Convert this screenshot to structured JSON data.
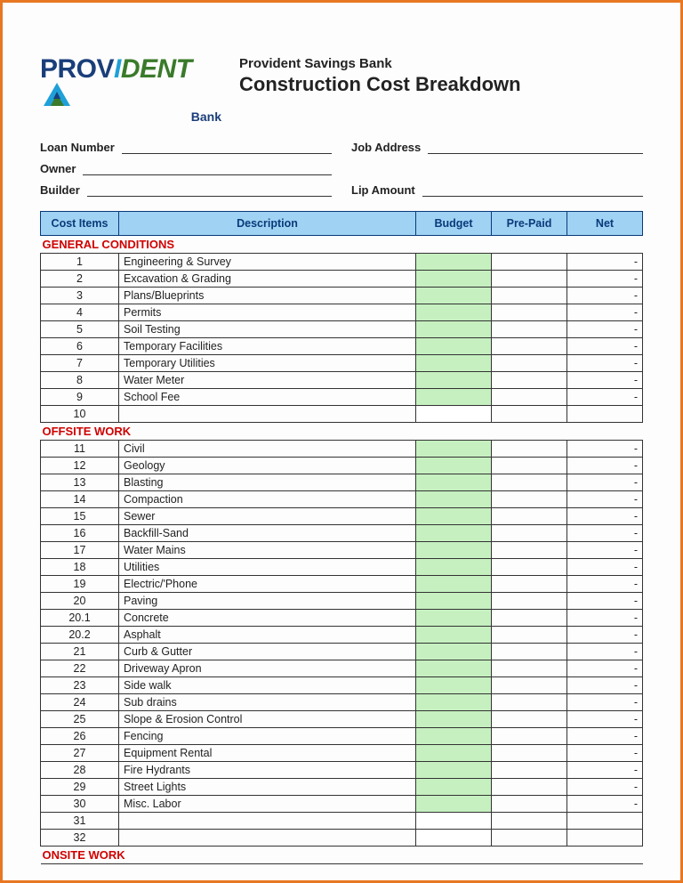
{
  "logo": {
    "text_prov": "PROV",
    "text_i": "I",
    "text_dent": "DENT",
    "sub": "Bank"
  },
  "header": {
    "bank": "Provident Savings Bank",
    "title": "Construction Cost Breakdown"
  },
  "form": {
    "loan_number": "Loan Number",
    "job_address": "Job Address",
    "owner": "Owner",
    "builder": "Builder",
    "lip_amount": "Lip Amount"
  },
  "columns": {
    "cost_items": "Cost  Items",
    "description": "Description",
    "budget": "Budget",
    "prepaid": "Pre-Paid",
    "net": "Net"
  },
  "sections": [
    {
      "title": "GENERAL CONDITIONS",
      "rows": [
        {
          "n": "1",
          "desc": "Engineering & Survey",
          "net": "-"
        },
        {
          "n": "2",
          "desc": "Excavation & Grading",
          "net": "-"
        },
        {
          "n": "3",
          "desc": "Plans/Blueprints",
          "net": "-"
        },
        {
          "n": "4",
          "desc": "Permits",
          "net": "-"
        },
        {
          "n": "5",
          "desc": "Soil Testing",
          "net": "-"
        },
        {
          "n": "6",
          "desc": "Temporary Facilities",
          "net": "-"
        },
        {
          "n": "7",
          "desc": "Temporary Utilities",
          "net": "-"
        },
        {
          "n": "8",
          "desc": "Water Meter",
          "net": "-"
        },
        {
          "n": "9",
          "desc": "School Fee",
          "net": "-"
        },
        {
          "n": "10",
          "desc": "",
          "net": "",
          "blank": true
        }
      ]
    },
    {
      "title": "OFFSITE WORK",
      "rows": [
        {
          "n": "11",
          "desc": "Civil",
          "net": "-"
        },
        {
          "n": "12",
          "desc": "Geology",
          "net": "-"
        },
        {
          "n": "13",
          "desc": "Blasting",
          "net": "-"
        },
        {
          "n": "14",
          "desc": "Compaction",
          "net": "-"
        },
        {
          "n": "15",
          "desc": "Sewer",
          "net": "-"
        },
        {
          "n": "16",
          "desc": "Backfill-Sand",
          "net": "-"
        },
        {
          "n": "17",
          "desc": "Water Mains",
          "net": "-"
        },
        {
          "n": "18",
          "desc": "Utilities",
          "net": "-"
        },
        {
          "n": "19",
          "desc": "Electric/'Phone",
          "net": "-"
        },
        {
          "n": "20",
          "desc": "Paving",
          "net": "-"
        },
        {
          "n": "20.1",
          "desc": "Concrete",
          "net": "-"
        },
        {
          "n": "20.2",
          "desc": "Asphalt",
          "net": "-"
        },
        {
          "n": "21",
          "desc": "Curb & Gutter",
          "net": "-"
        },
        {
          "n": "22",
          "desc": "Driveway Apron",
          "net": "-"
        },
        {
          "n": "23",
          "desc": "Side walk",
          "net": "-"
        },
        {
          "n": "24",
          "desc": "Sub drains",
          "net": "-"
        },
        {
          "n": "25",
          "desc": "Slope & Erosion Control",
          "net": "-"
        },
        {
          "n": "26",
          "desc": "Fencing",
          "net": "-"
        },
        {
          "n": "27",
          "desc": "Equipment Rental",
          "net": "-"
        },
        {
          "n": "28",
          "desc": "Fire Hydrants",
          "net": "-"
        },
        {
          "n": "29",
          "desc": "Street Lights",
          "net": "-"
        },
        {
          "n": "30",
          "desc": "Misc. Labor",
          "net": "-"
        },
        {
          "n": "31",
          "desc": "",
          "net": "",
          "blank": true
        },
        {
          "n": "32",
          "desc": "",
          "net": "",
          "blank": true
        }
      ]
    },
    {
      "title": "ONSITE WORK",
      "rows": []
    }
  ]
}
